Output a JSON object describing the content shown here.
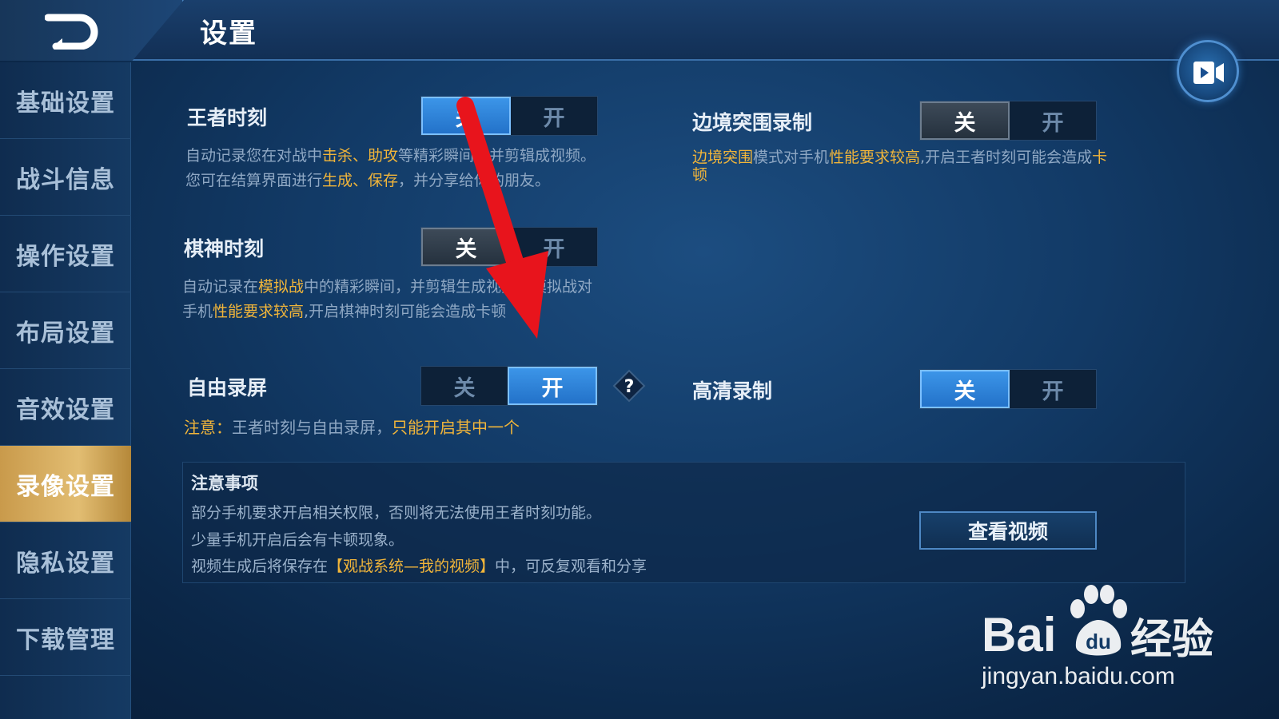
{
  "header": {
    "title": "设置"
  },
  "sidebar": {
    "items": [
      {
        "label": "基础设置"
      },
      {
        "label": "战斗信息"
      },
      {
        "label": "操作设置"
      },
      {
        "label": "布局设置"
      },
      {
        "label": "音效设置"
      },
      {
        "label": "录像设置",
        "active": true
      },
      {
        "label": "隐私设置"
      },
      {
        "label": "下载管理"
      }
    ]
  },
  "settings": {
    "wangzhe": {
      "label": "王者时刻",
      "off": "关",
      "on": "开",
      "selected": "关",
      "desc_l1": [
        "自动记录您在对战中",
        "击杀、助攻",
        "等精彩瞬间，并剪辑成视频。"
      ],
      "desc_l2": [
        "您可在结算界面进行",
        "生成、保存",
        "，并分享给你的朋友。"
      ]
    },
    "border": {
      "label": "边境突围录制",
      "off": "关",
      "on": "开",
      "selected": "关",
      "desc_l1": [
        "边境突围",
        "模式对手机",
        "性能要求较高",
        ",开启王者时刻可能会造成",
        "卡"
      ],
      "desc_l2": [
        "顿"
      ]
    },
    "qishen": {
      "label": "棋神时刻",
      "off": "关",
      "on": "开",
      "selected": "关",
      "desc_l1": [
        "自动记录在",
        "模拟战",
        "中的精彩瞬间，并剪辑生成视频。模拟战对"
      ],
      "desc_l2": [
        "手机",
        "性能要求较高",
        ",开启棋神时刻可能会造成卡顿"
      ]
    },
    "free_record": {
      "label": "自由录屏",
      "off": "关",
      "on": "开",
      "selected": "开",
      "help": "?",
      "note": [
        "注意：",
        "王者时刻与自由录屏，",
        "只能开启其中一个"
      ]
    },
    "hd": {
      "label": "高清录制",
      "off": "关",
      "on": "开",
      "selected": "关"
    }
  },
  "notes": {
    "title": "注意事项",
    "line1": "部分手机要求开启相关权限，否则将无法使用王者时刻功能。",
    "line2": "少量手机开启后会有卡顿现象。",
    "line3": [
      "视频生成后将保存在",
      "【观战系统—我的视频】",
      "中，可反复观看和分享"
    ],
    "view_button": "查看视频"
  },
  "watermark": {
    "bai": "Bai",
    "du": "du",
    "jingyan": "经验",
    "url": "jingyan.baidu.com"
  },
  "icons": {
    "back": "back-arrow-icon",
    "video": "video-camera-icon",
    "help": "question-mark-icon",
    "annotation": "red-arrow-annotation"
  },
  "colors": {
    "highlight": "#f1b53a",
    "selected_blue": "#2f86dc",
    "active_tab_gold": "#d8ae5f",
    "annotation_red": "#e8141c"
  }
}
